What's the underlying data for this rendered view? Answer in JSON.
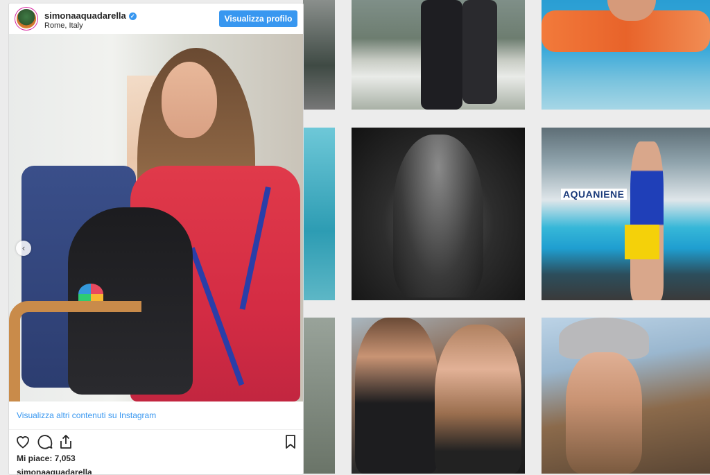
{
  "post": {
    "username": "simonaaquadarella",
    "location": "Rome, Italy",
    "profile_button": "Visualizza profilo",
    "more_link": "Visualizza altri contenuti su Instagram",
    "likes": "Mi piace: 7,053",
    "caption_user": "simonaaquadarella",
    "verified": true,
    "accent_color": "#3897f0"
  },
  "grid": {
    "tile_labels": [
      "AQUANIENE"
    ]
  }
}
